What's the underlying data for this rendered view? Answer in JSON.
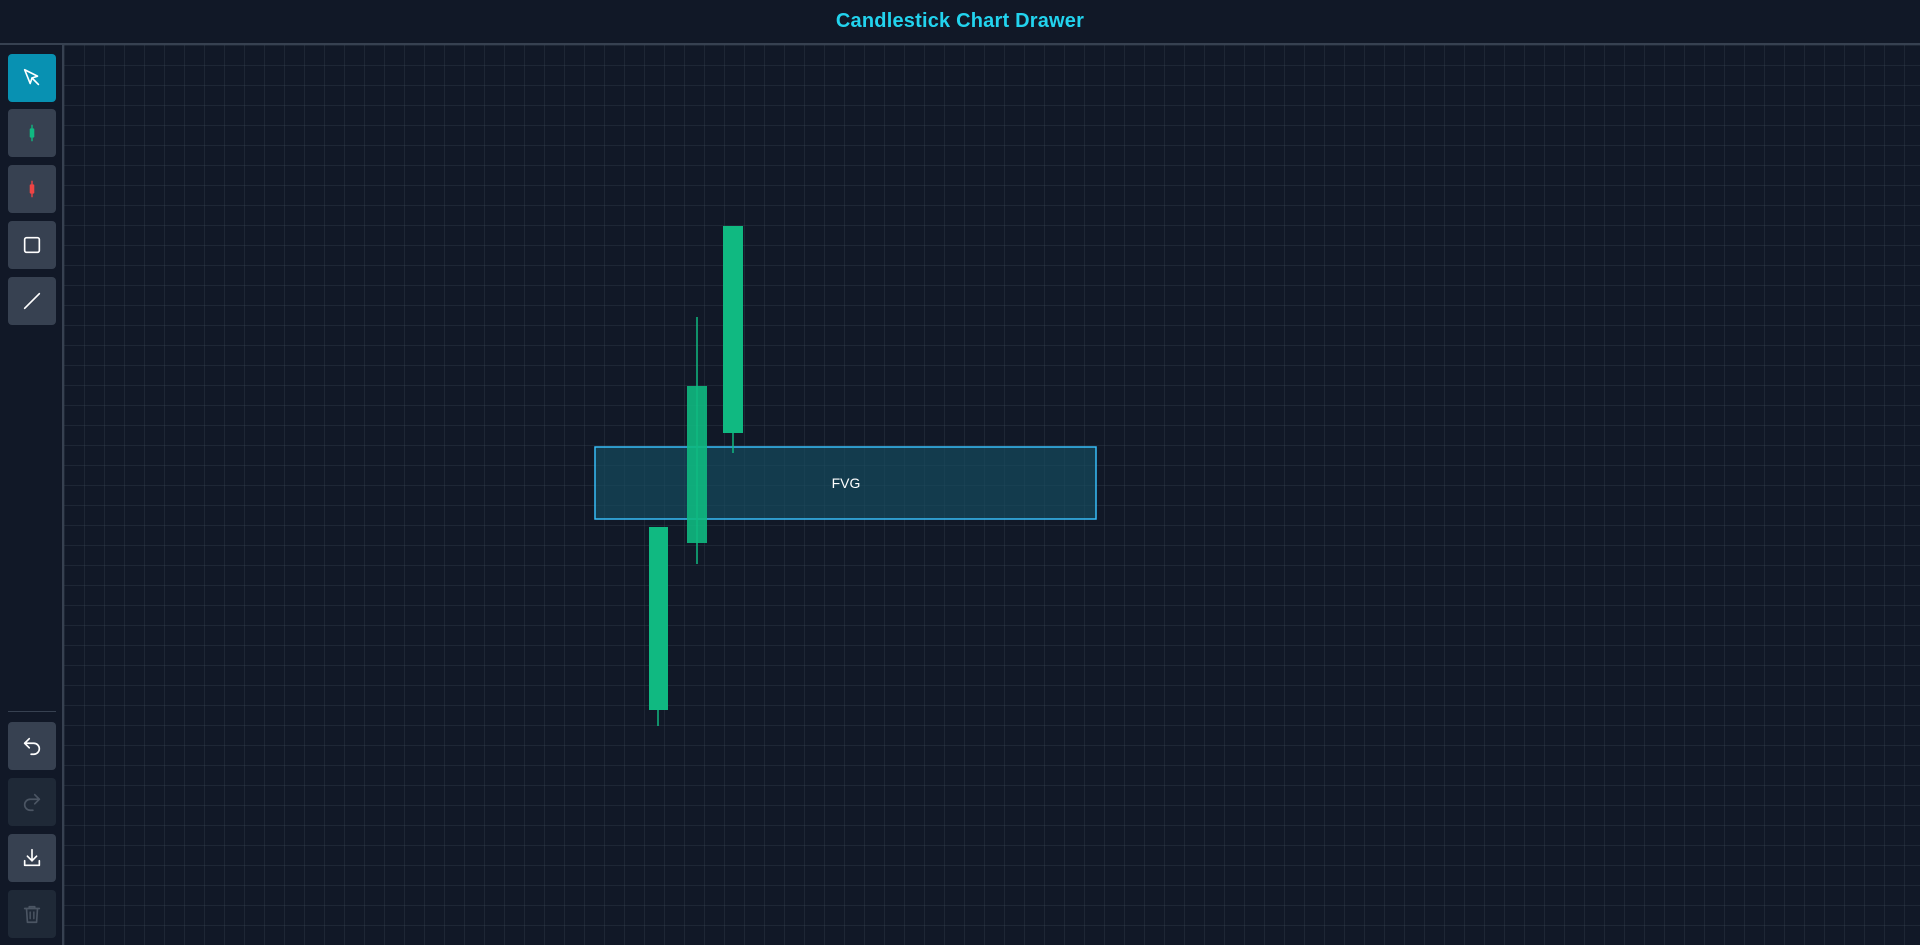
{
  "app": {
    "title": "Candlestick Chart Drawer"
  },
  "toolbar": {
    "tools": [
      {
        "id": "select",
        "icon": "cursor-arrow-icon",
        "active": true
      },
      {
        "id": "bullish-candle",
        "icon": "bullish-candle-icon",
        "active": false
      },
      {
        "id": "bearish-candle",
        "icon": "bearish-candle-icon",
        "active": false
      },
      {
        "id": "rectangle",
        "icon": "rectangle-icon",
        "active": false
      },
      {
        "id": "line",
        "icon": "line-icon",
        "active": false
      }
    ],
    "actions": [
      {
        "id": "undo",
        "icon": "undo-icon",
        "enabled": true
      },
      {
        "id": "redo",
        "icon": "redo-icon",
        "enabled": false
      },
      {
        "id": "download",
        "icon": "download-icon",
        "enabled": true
      },
      {
        "id": "clear",
        "icon": "trash-icon",
        "enabled": false
      }
    ]
  },
  "colors": {
    "accent": "#22d3ee",
    "active_tool": "#0891b2",
    "bullish": "#10b981",
    "bearish": "#ef4444",
    "zone_fill": "#164e63",
    "zone_border": "#38bdf8"
  },
  "drawing": {
    "candles": [
      {
        "type": "bullish"
      },
      {
        "type": "bullish"
      },
      {
        "type": "bullish"
      }
    ],
    "zones": [
      {
        "label": "FVG"
      }
    ]
  }
}
